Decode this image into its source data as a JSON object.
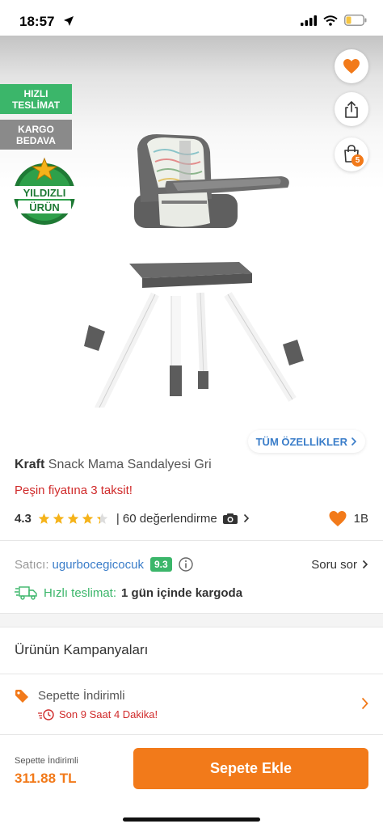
{
  "status_bar": {
    "time": "18:57"
  },
  "badges": {
    "fast_delivery": [
      "HIZLI",
      "TESLİMAT"
    ],
    "free_shipping": [
      "KARGO",
      "BEDAVA"
    ],
    "star_product": [
      "YILDIZLI",
      "ÜRÜN"
    ]
  },
  "header": {
    "cart_count": "5"
  },
  "product": {
    "all_features_label": "TÜM ÖZELLİKLER",
    "brand": "Kraft",
    "name": "Snack Mama Sandalyesi Gri",
    "installment_text": "Peşin fiyatına 3 taksit!",
    "rating": "4.3",
    "rating_value": 4.3,
    "review_text": "| 60 değerlendirme",
    "favorite_count": "1B"
  },
  "seller": {
    "label": "Satıcı:",
    "name": "ugurbocegicocuk",
    "score": "9.3",
    "ask_label": "Soru sor"
  },
  "shipping": {
    "label": "Hızlı teslimat:",
    "value": "1 gün içinde kargoda"
  },
  "campaigns": {
    "title": "Ürünün Kampanyaları",
    "item_title": "Sepette İndirimli",
    "item_countdown": "Son 9 Saat 4 Dakika!"
  },
  "bottom_bar": {
    "price_label": "Sepette İndirimli",
    "price": "311.88 TL",
    "add_to_cart": "Sepete Ekle"
  },
  "colors": {
    "accent": "#f27a1a",
    "green": "#3bb66a",
    "link_blue": "#3a7dc9",
    "alert_red": "#d02b2b",
    "star": "#f5b31a"
  },
  "icons": [
    "back-arrow-icon",
    "heart-icon",
    "share-icon",
    "cart-icon",
    "chevron-right-icon",
    "camera-icon",
    "info-icon",
    "truck-icon",
    "tag-icon",
    "clock-icon",
    "star-icon",
    "location-arrow-icon",
    "signal-icon",
    "wifi-icon",
    "battery-icon"
  ]
}
